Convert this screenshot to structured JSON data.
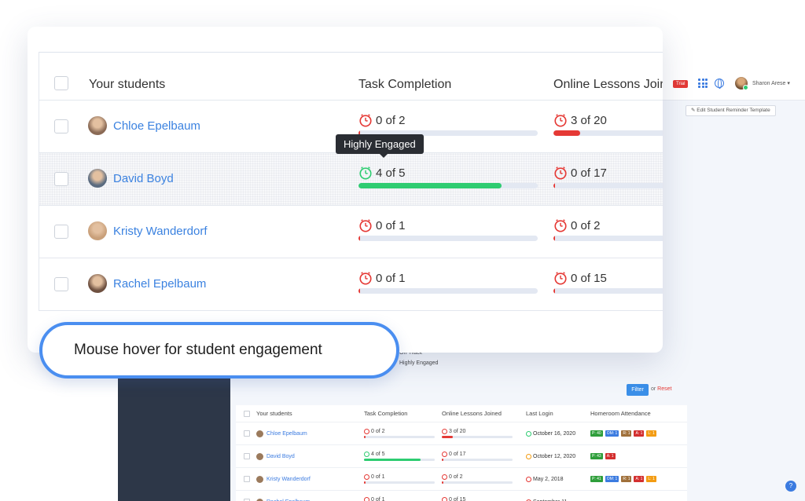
{
  "colors": {
    "accent": "#3b82e0",
    "red": "#e53935",
    "green": "#2ecc71",
    "orange": "#f39c12",
    "tooltip": "#2a2d33"
  },
  "background": {
    "trial_badge": "Trial",
    "user_name": "Sharon Arese ▾",
    "edit_template_button": "✎  Edit Student Reminder Template",
    "legend_on_track": "On-Track",
    "legend_highly_engaged": "Highly Engaged",
    "filter_button": "Filter",
    "or_text": "or ",
    "reset_link": "Reset",
    "help_icon": "?",
    "table": {
      "headers": [
        "Your students",
        "Task Completion",
        "Online Lessons Joined",
        "Last Login",
        "Homeroom Attendance"
      ],
      "rows": [
        {
          "name": "Chloe Epelbaum",
          "task": "0 of 2",
          "lessons": "3 of 20",
          "login": "October 16, 2020",
          "badges": [
            "P: 40",
            "OM: 1",
            "R: 1",
            "A: 1",
            "L: 1"
          ]
        },
        {
          "name": "David Boyd",
          "task": "4 of 5",
          "lessons": "0 of 17",
          "login": "October 12, 2020",
          "badges": [
            "P: 43",
            "A: 1"
          ]
        },
        {
          "name": "Kristy Wanderdorf",
          "task": "0 of 1",
          "lessons": "0 of 2",
          "login": "May 2, 2018",
          "badges": [
            "P: 41",
            "OM: 1",
            "R: 1",
            "A: 1",
            "L: 1"
          ]
        },
        {
          "name": "Rachel Epelbaum",
          "task": "0 of 1",
          "lessons": "0 of 15",
          "login": "September 11",
          "badges": []
        }
      ]
    }
  },
  "card": {
    "headers": {
      "students": "Your students",
      "task": "Task Completion",
      "lessons": "Online Lessons Join"
    },
    "rows": [
      {
        "name": "Chloe Epelbaum",
        "task": "0 of 2",
        "task_progress": 0.0,
        "task_status": "red",
        "lessons": "3 of 20",
        "lessons_progress": 0.15,
        "lessons_status": "red"
      },
      {
        "name": "David Boyd",
        "task": "4 of 5",
        "task_progress": 0.8,
        "task_status": "green",
        "lessons": "0 of 17",
        "lessons_progress": 0.0,
        "lessons_status": "red"
      },
      {
        "name": "Kristy Wanderdorf",
        "task": "0 of 1",
        "task_progress": 0.0,
        "task_status": "red",
        "lessons": "0 of 2",
        "lessons_progress": 0.0,
        "lessons_status": "red"
      },
      {
        "name": "Rachel Epelbaum",
        "task": "0 of 1",
        "task_progress": 0.0,
        "task_status": "red",
        "lessons": "0 of 15",
        "lessons_progress": 0.0,
        "lessons_status": "red"
      }
    ],
    "tooltip": "Highly Engaged"
  },
  "callout": {
    "text": "Mouse hover for student engagement"
  }
}
